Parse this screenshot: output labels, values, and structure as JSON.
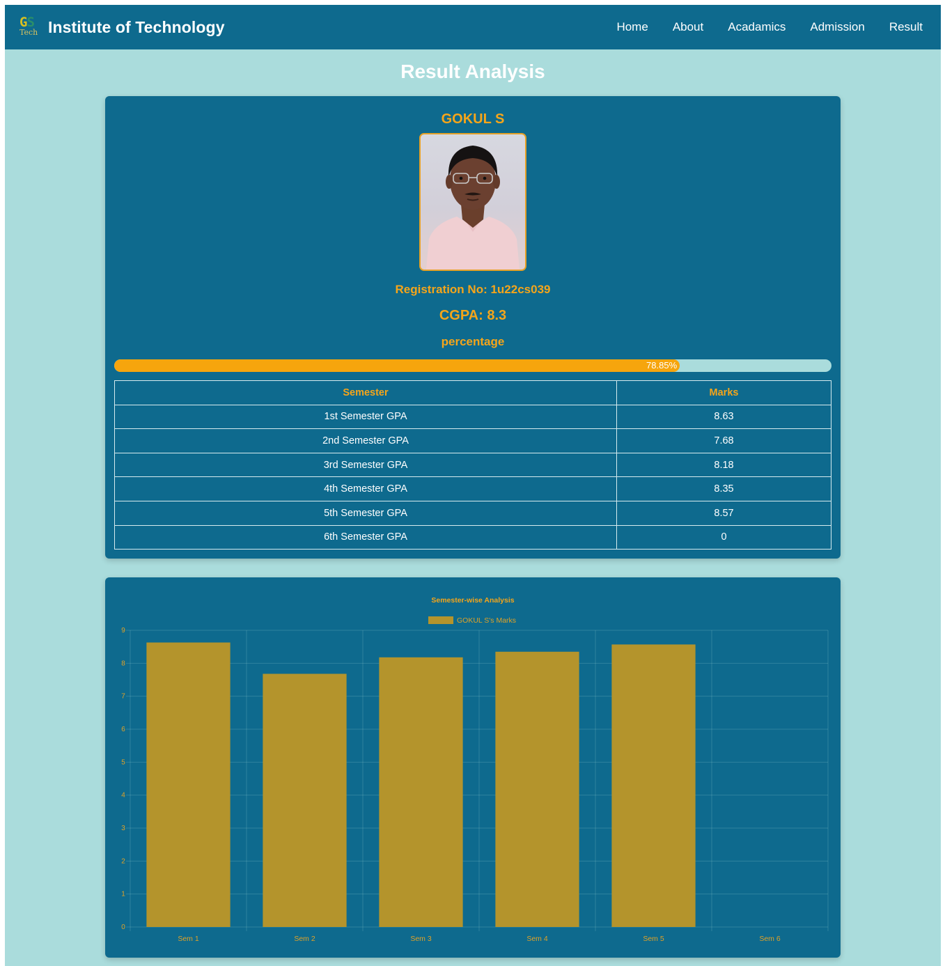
{
  "navbar": {
    "logo_main": "GS",
    "logo_sub": "Tech",
    "title": "Institute of Technology",
    "links": [
      "Home",
      "About",
      "Acadamics",
      "Admission",
      "Result"
    ]
  },
  "page_title": "Result Analysis",
  "student": {
    "name": "GOKUL S",
    "registration": "Registration No: 1u22cs039",
    "cgpa": "CGPA: 8.3",
    "percentage_label": "percentage",
    "percentage_value": 78.85,
    "percentage_text": "78.85%"
  },
  "table": {
    "headers": [
      "Semester",
      "Marks"
    ],
    "rows": [
      [
        "1st Semester GPA",
        "8.63"
      ],
      [
        "2nd Semester GPA",
        "7.68"
      ],
      [
        "3rd Semester GPA",
        "8.18"
      ],
      [
        "4th Semester GPA",
        "8.35"
      ],
      [
        "5th Semester GPA",
        "8.57"
      ],
      [
        "6th Semester GPA",
        "0"
      ]
    ]
  },
  "colors": {
    "navbar": "#0e6a8e",
    "background": "#aadcdc",
    "accent": "#f5a51a",
    "bar": "#b4942c"
  },
  "chart_data": {
    "type": "bar",
    "title": "Semester-wise Analysis",
    "categories": [
      "Sem 1",
      "Sem 2",
      "Sem 3",
      "Sem 4",
      "Sem 5",
      "Sem 6"
    ],
    "series": [
      {
        "name": "GOKUL S's Marks",
        "values": [
          8.63,
          7.68,
          8.18,
          8.35,
          8.57,
          0
        ]
      }
    ],
    "ylim": [
      0,
      9
    ],
    "yticks": [
      0,
      1,
      2,
      3,
      4,
      5,
      6,
      7,
      8,
      9
    ],
    "legend": "top-center",
    "grid": true
  }
}
